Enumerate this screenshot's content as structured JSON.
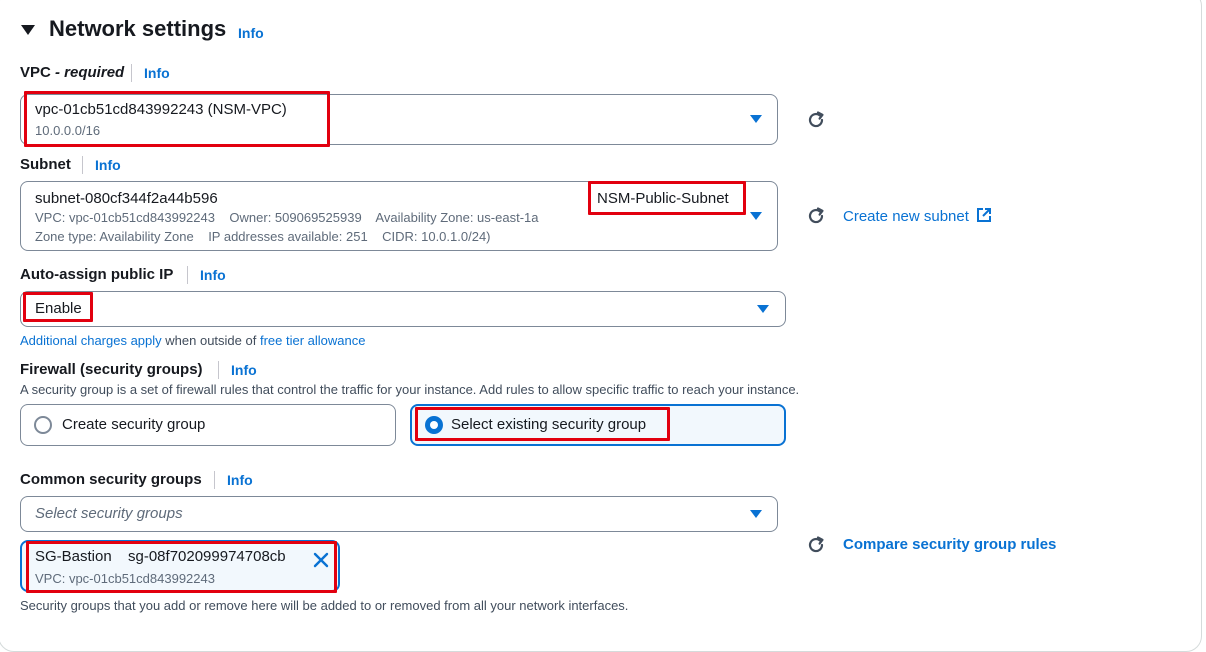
{
  "section": {
    "title": "Network settings",
    "info": "Info"
  },
  "vpc": {
    "label": "VPC",
    "required": "- required",
    "info": "Info",
    "value": "vpc-01cb51cd843992243 (NSM-VPC)",
    "cidr": "10.0.0.0/16"
  },
  "subnet": {
    "label": "Subnet",
    "info": "Info",
    "id": "subnet-080cf344f2a44b596",
    "name": "NSM-Public-Subnet",
    "line2": "VPC: vpc-01cb51cd843992243    Owner: 509069525939    Availability Zone: us-east-1a",
    "line3": "Zone type: Availability Zone    IP addresses available: 251    CIDR: 10.0.1.0/24)",
    "create_link": "Create new subnet"
  },
  "auto_assign": {
    "label": "Auto-assign public IP",
    "info": "Info",
    "value": "Enable",
    "note_link1": "Additional charges apply",
    "note_text": " when outside of ",
    "note_link2": "free tier allowance"
  },
  "firewall": {
    "label": "Firewall (security groups)",
    "info": "Info",
    "description": "A security group is a set of firewall rules that control the traffic for your instance. Add rules to allow specific traffic to reach your instance.",
    "option_create": "Create security group",
    "option_select": "Select existing security group",
    "selected": "Select existing security group"
  },
  "common_sg": {
    "label": "Common security groups",
    "info": "Info",
    "placeholder": "Select security groups",
    "token_name": "SG-Bastion",
    "token_id": "sg-08f702099974708cb",
    "token_vpc": "VPC: vpc-01cb51cd843992243",
    "compare_link": "Compare security group rules",
    "footnote": "Security groups that you add or remove here will be added to or removed from all your network interfaces."
  },
  "colors": {
    "accent": "#0972d3",
    "highlight": "#e2000f",
    "selected_bg": "#f2f8fd"
  }
}
